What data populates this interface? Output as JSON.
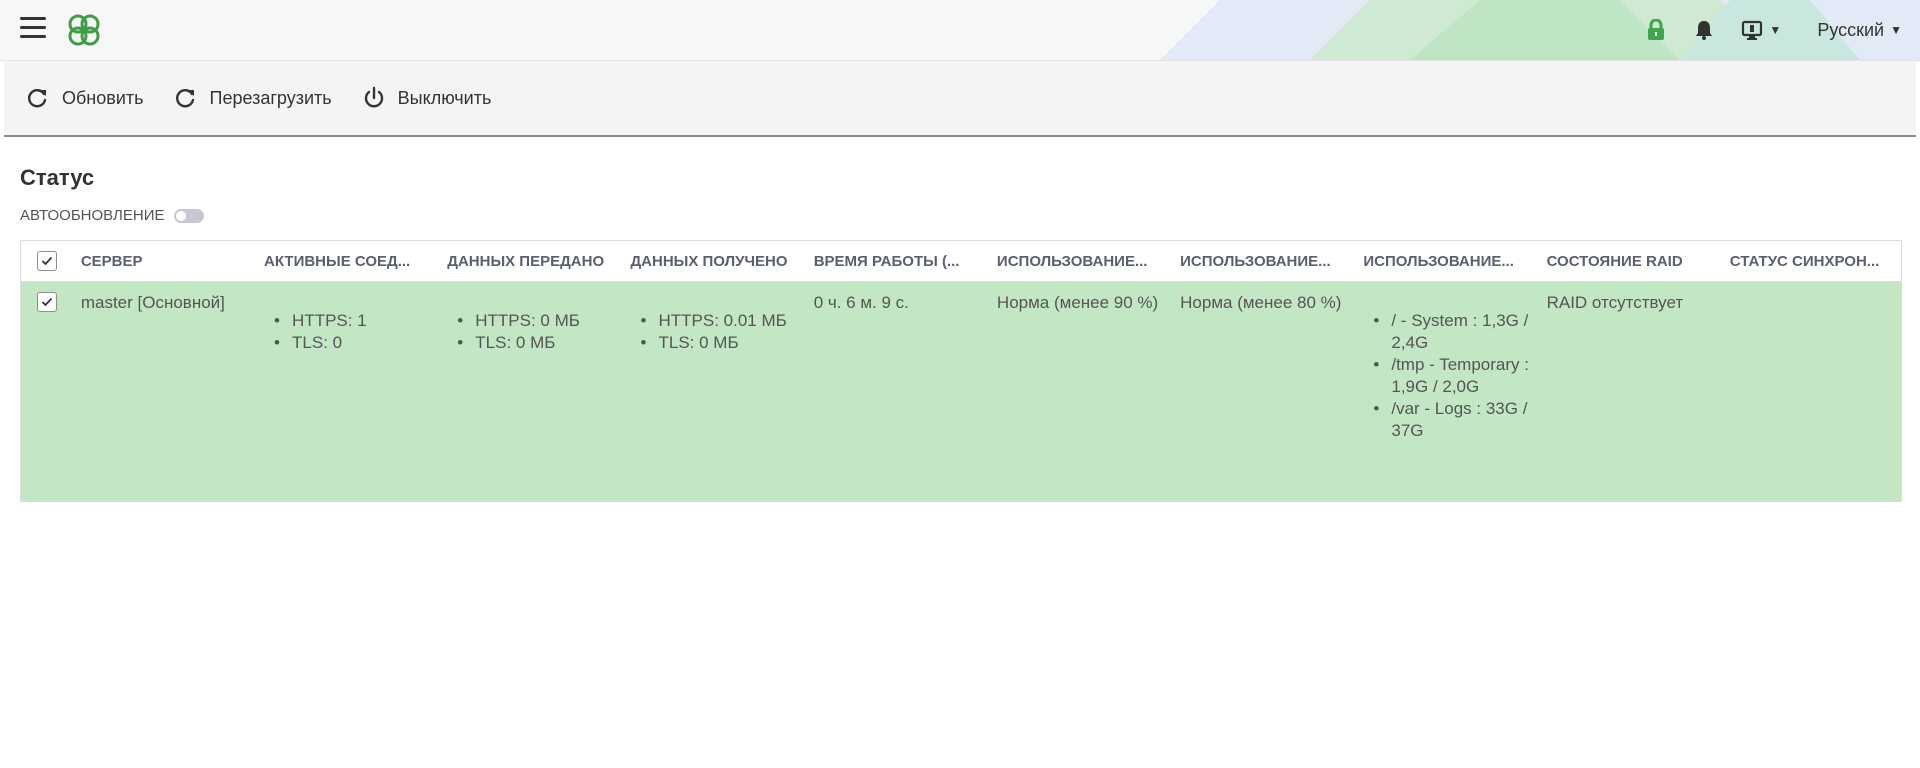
{
  "header": {
    "language": "Русский",
    "colors": {
      "accent": "#3f9d46",
      "lock": "#3aa84b"
    },
    "icons": [
      "menu-icon",
      "logo-icon",
      "lock-icon",
      "bell-icon",
      "monitor-icon",
      "chevron-down-icon"
    ]
  },
  "toolbar": {
    "refresh_label": "Обновить",
    "reboot_label": "Перезагрузить",
    "shutdown_label": "Выключить"
  },
  "page": {
    "title": "Статус",
    "autorefresh_label": "АВТООБНОВЛЕНИЕ",
    "autorefresh_on": false
  },
  "table": {
    "columns": [
      "СЕРВЕР",
      "АКТИВНЫЕ СОЕД...",
      "ДАННЫХ ПЕРЕДАНО",
      "ДАННЫХ ПОЛУЧЕНО",
      "ВРЕМЯ РАБОТЫ (...",
      "ИСПОЛЬЗОВАНИЕ...",
      "ИСПОЛЬЗОВАНИЕ...",
      "ИСПОЛЬЗОВАНИЕ...",
      "СОСТОЯНИЕ RAID",
      "СТАТУС СИНХРОН..."
    ],
    "row": {
      "server": "master [Основной]",
      "active_connections": [
        "HTTPS: 1",
        "TLS: 0"
      ],
      "data_sent": [
        "HTTPS: 0 МБ",
        "TLS: 0 МБ"
      ],
      "data_received": [
        "HTTPS: 0.01 МБ",
        "TLS: 0 МБ"
      ],
      "uptime": "0 ч. 6 м. 9 с.",
      "usage_1": "Норма (менее 90 %)",
      "usage_2": "Норма (менее 80 %)",
      "disk_usage": [
        "/ - System : 1,3G / 2,4G",
        "/tmp - Temporary : 1,9G / 2,0G",
        "/var - Logs : 33G / 37G"
      ],
      "raid": "RAID отсутствует",
      "sync": ""
    },
    "row_color": "#c3e6c5"
  }
}
